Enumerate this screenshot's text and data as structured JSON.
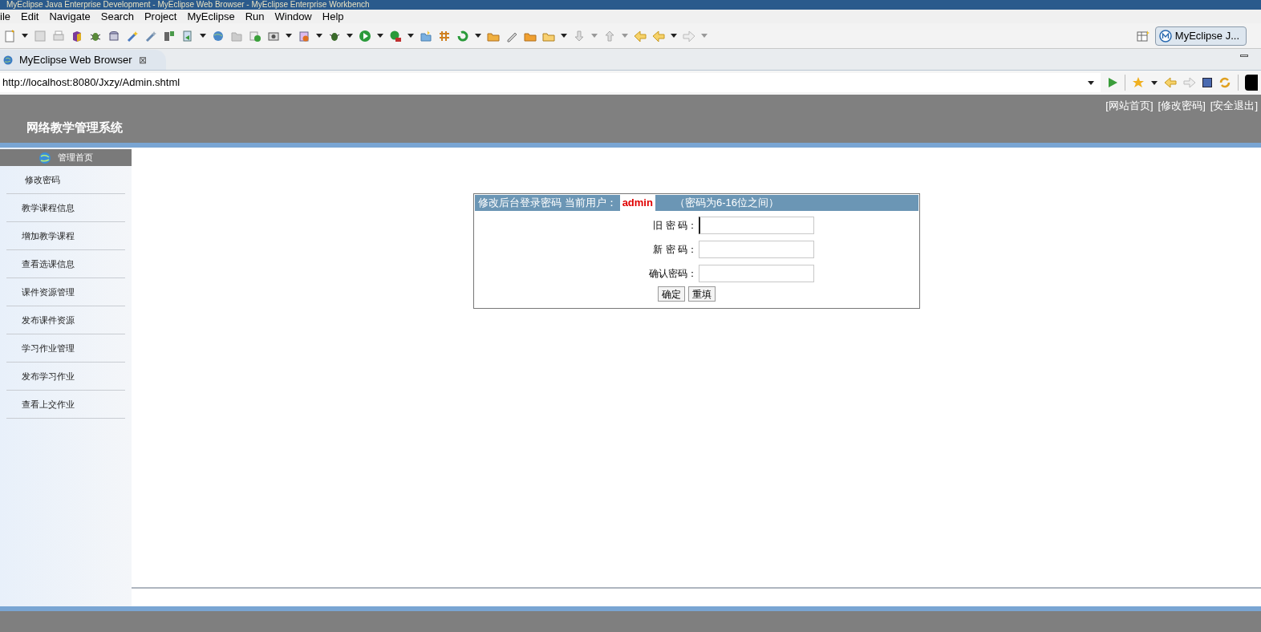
{
  "window": {
    "title": "MyEclipse Java Enterprise Development - MyEclipse Web Browser - MyEclipse Enterprise Workbench"
  },
  "menu": [
    "ile",
    "Edit",
    "Navigate",
    "Search",
    "Project",
    "MyEclipse",
    "Run",
    "Window",
    "Help"
  ],
  "perspective": {
    "label": "MyEclipse J..."
  },
  "editor_tab": {
    "label": "MyEclipse Web Browser",
    "close": "⊠"
  },
  "address": {
    "value": "http://localhost:8080/Jxzy/Admin.shtml"
  },
  "site": {
    "title": "网络教学管理系统",
    "top_links": [
      "[网站首页]",
      "[修改密码]",
      "[安全退出]"
    ]
  },
  "sidebar": {
    "heading": "管理首页",
    "items": [
      {
        "label": "修改密码"
      },
      {
        "label": "教学课程信息"
      },
      {
        "label": "增加教学课程"
      },
      {
        "label": "查看选课信息"
      },
      {
        "label": "课件资源管理"
      },
      {
        "label": "发布课件资源"
      },
      {
        "label": "学习作业管理"
      },
      {
        "label": "发布学习作业"
      },
      {
        "label": "查看上交作业"
      }
    ]
  },
  "form": {
    "title": "修改后台登录密码 当前用户：",
    "user": "admin",
    "hint": "（密码为6-16位之间）",
    "fields": [
      {
        "label": "旧 密 码：",
        "focused": true
      },
      {
        "label": "新 密 码：",
        "focused": false
      },
      {
        "label": "确认密码：",
        "focused": false
      }
    ],
    "buttons": [
      "确定",
      "重填"
    ]
  }
}
